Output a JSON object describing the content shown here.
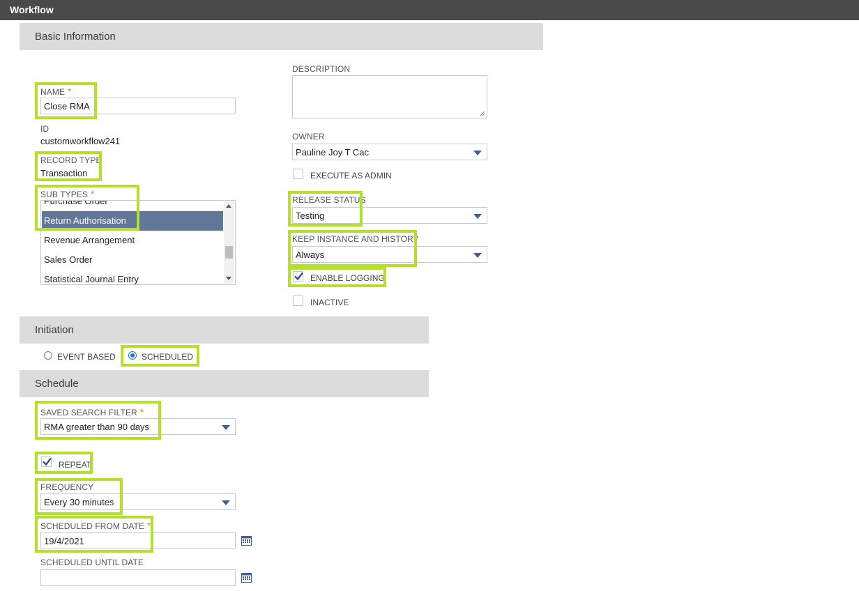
{
  "window": {
    "title": "Workflow"
  },
  "sections": {
    "basic": "Basic Information",
    "initiation": "Initiation",
    "schedule": "Schedule"
  },
  "basic": {
    "name": {
      "label": "NAME",
      "required": "*",
      "value": "Close RMA"
    },
    "id": {
      "label": "ID",
      "value": "customworkflow241"
    },
    "record_type": {
      "label": "RECORD TYPE",
      "value": "Transaction"
    },
    "sub_types": {
      "label": "SUB TYPES",
      "required": "*",
      "items": [
        "Purchase Order",
        "Return Authorisation",
        "Revenue Arrangement",
        "Sales Order",
        "Statistical Journal Entry"
      ],
      "selected": "Return Authorisation"
    },
    "description": {
      "label": "DESCRIPTION",
      "value": ""
    },
    "owner": {
      "label": "OWNER",
      "value": "Pauline Joy T Cac"
    },
    "execute_as_admin": {
      "label": "EXECUTE AS ADMIN",
      "checked": false
    },
    "release_status": {
      "label": "RELEASE STATUS",
      "value": "Testing"
    },
    "keep_instance": {
      "label": "KEEP INSTANCE AND HISTORY",
      "value": "Always"
    },
    "enable_logging": {
      "label": "ENABLE LOGGING",
      "checked": true
    },
    "inactive": {
      "label": "INACTIVE",
      "checked": false
    }
  },
  "initiation": {
    "event_based": {
      "label": "EVENT BASED",
      "selected": false
    },
    "scheduled": {
      "label": "SCHEDULED",
      "selected": true
    }
  },
  "schedule": {
    "saved_search": {
      "label": "SAVED SEARCH FILTER",
      "required": "*",
      "value": "RMA greater than 90 days"
    },
    "repeat": {
      "label": "REPEAT",
      "checked": true
    },
    "frequency": {
      "label": "FREQUENCY",
      "value": "Every 30 minutes"
    },
    "from_date": {
      "label": "SCHEDULED FROM DATE",
      "required": "*",
      "value": "19/4/2021"
    },
    "until_date": {
      "label": "SCHEDULED UNTIL DATE",
      "value": ""
    }
  },
  "colors": {
    "highlight": "#b5e02a",
    "accent": "#3f5f8c",
    "selected_row": "#607799",
    "titlebar": "#4a4a4a",
    "section": "#dcdcdc"
  },
  "icons": {
    "dropdown": "chevron-down-icon",
    "calendar": "calendar-icon",
    "check": "checkmark-icon"
  }
}
